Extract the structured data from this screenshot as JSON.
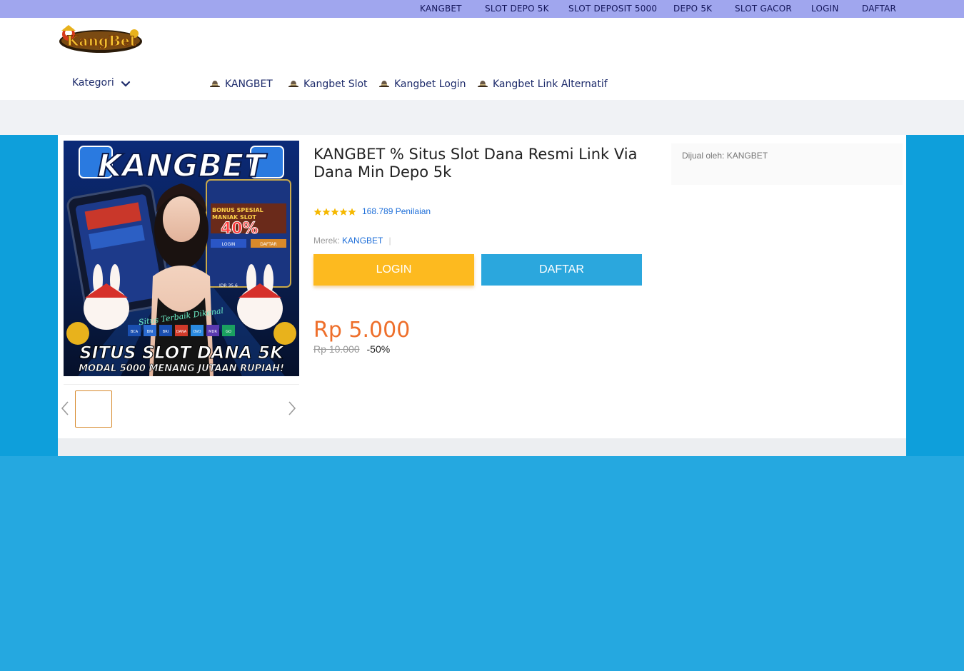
{
  "top_nav": [
    "KANGBET",
    "SLOT DEPO 5K",
    "SLOT DEPOSIT 5000",
    "DEPO 5K",
    "SLOT GACOR",
    "LOGIN",
    "DAFTAR"
  ],
  "header": {
    "logo_text": "KangBet",
    "kategori_label": "Kategori",
    "menu": [
      "KANGBET",
      "Kangbet Slot",
      "Kangbet Login",
      "Kangbet Link Alternatif"
    ]
  },
  "product": {
    "title": "KANGBET % Situs Slot Dana Resmi Link Via Dana Min Depo 5k",
    "rating_stars": 5,
    "rating_text": "168.789 Penilaian",
    "brand_label": "Merek:",
    "brand_value": "KANGBET",
    "login_label": "LOGIN",
    "daftar_label": "DAFTAR",
    "price": "Rp 5.000",
    "old_price": "Rp 10.000",
    "discount": "-50%",
    "seller_text": "Dijual oleh: KANGBET"
  },
  "banner": {
    "headline": "KANGBET",
    "bottom_line1": "SITUS SLOT DANA 5K",
    "bottom_line2": "MODAL 5000 MENANG JUTAAN RUPIAH!",
    "promo_line1": "BONUS SPESIAL",
    "promo_line2": "MANIAK SLOT",
    "promo_value": "40%",
    "tagline": "Situs Terbaik Dikenal",
    "phone_login": "LOGIN",
    "phone_daftar": "DAFTAR",
    "phone_balance": "IDR 35.6",
    "payments": [
      "BCA",
      "BNI",
      "BRI",
      "DANA",
      "OVO",
      "MDR",
      "GO"
    ]
  },
  "colors": {
    "topbar_bg": "#a0a6ee",
    "page_blue": "#25a8e0",
    "band_blue": "#0e9fdb",
    "login_yellow": "#fdba1f",
    "daftar_blue": "#2ba7dd",
    "price_orange": "#ee6f2b",
    "link_blue": "#1e6fd9",
    "star_gold": "#f5b800"
  },
  "icons": [
    "hat-icon",
    "chevron-down-icon",
    "chevron-left-icon",
    "chevron-right-icon",
    "star-icon"
  ]
}
